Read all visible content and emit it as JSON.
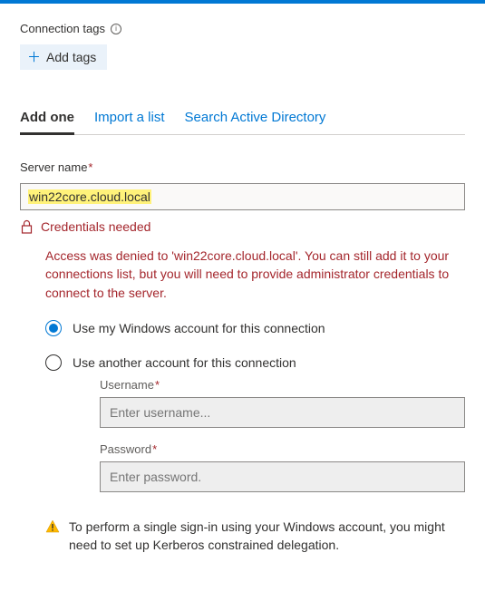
{
  "header": {
    "connection_tags_label": "Connection tags",
    "add_tags_label": "Add tags"
  },
  "tabs": {
    "add_one": "Add one",
    "import_list": "Import a list",
    "search_ad": "Search Active Directory"
  },
  "server": {
    "label": "Server name",
    "value": "win22core.cloud.local"
  },
  "error": {
    "title": "Credentials needed",
    "body": "Access was denied to 'win22core.cloud.local'. You can still add it to your connections list, but you will need to provide administrator credentials to connect to the server."
  },
  "auth": {
    "use_windows": "Use my Windows account for this connection",
    "use_other": "Use another account for this connection",
    "username_label": "Username",
    "username_placeholder": "Enter username...",
    "password_label": "Password",
    "password_placeholder": "Enter password."
  },
  "warning": {
    "text": "To perform a single sign-in using your Windows account, you might need to set up Kerberos constrained delegation."
  }
}
